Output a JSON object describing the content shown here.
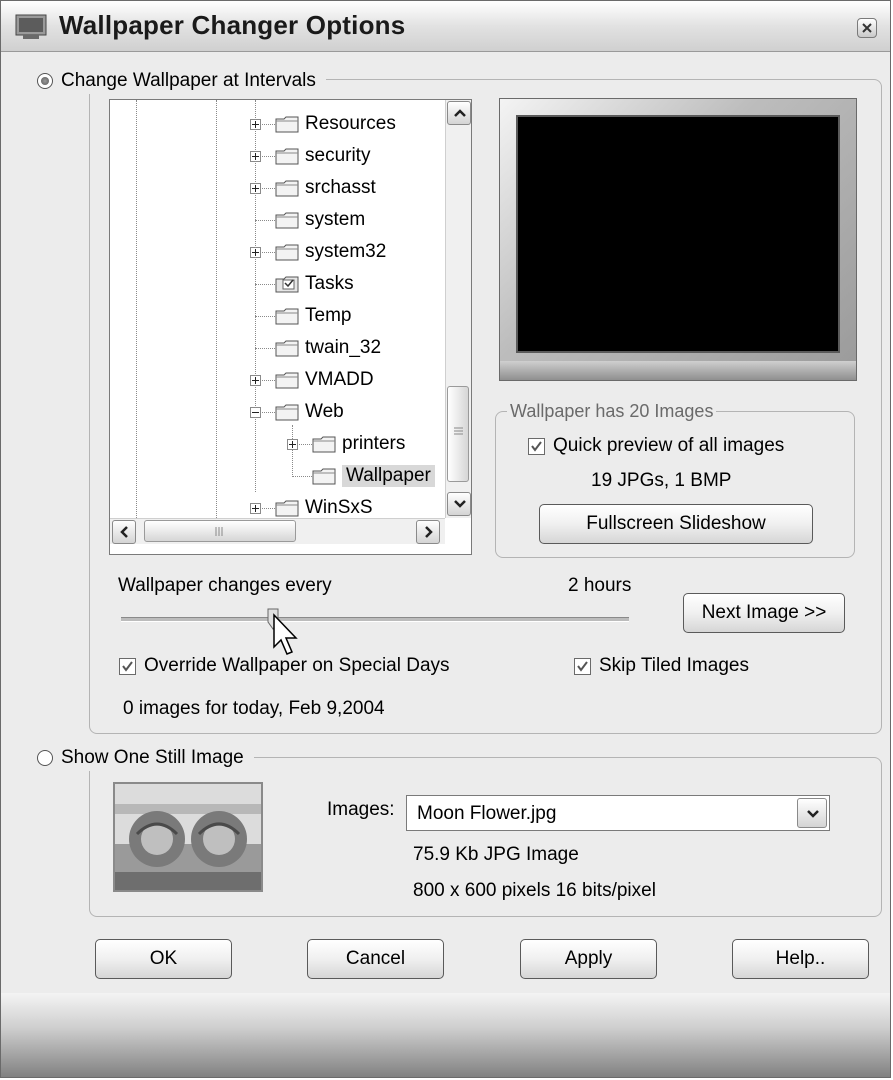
{
  "window": {
    "title": "Wallpaper Changer Options"
  },
  "intervals": {
    "radio_label": "Change Wallpaper at Intervals",
    "selected": true,
    "tree": [
      {
        "label": "Resources",
        "expander": "plus",
        "icon": "folder"
      },
      {
        "label": "security",
        "expander": "plus",
        "icon": "folder"
      },
      {
        "label": "srchasst",
        "expander": "plus",
        "icon": "folder"
      },
      {
        "label": "system",
        "expander": "none",
        "icon": "folder"
      },
      {
        "label": "system32",
        "expander": "plus",
        "icon": "folder"
      },
      {
        "label": "Tasks",
        "expander": "none",
        "icon": "tasks-folder"
      },
      {
        "label": "Temp",
        "expander": "none",
        "icon": "folder"
      },
      {
        "label": "twain_32",
        "expander": "none",
        "icon": "folder"
      },
      {
        "label": "VMADD",
        "expander": "plus",
        "icon": "folder"
      },
      {
        "label": "Web",
        "expander": "minus",
        "icon": "folder"
      },
      {
        "label": "printers",
        "expander": "plus",
        "icon": "folder"
      },
      {
        "label": "Wallpaper",
        "expander": "none",
        "icon": "folder",
        "selected": true
      },
      {
        "label": "WinSxS",
        "expander": "plus",
        "icon": "folder"
      }
    ],
    "info_group": {
      "legend": "Wallpaper has 20 Images",
      "quick_preview_label": "Quick preview of all images",
      "quick_preview_checked": true,
      "counts": "19 JPGs, 1 BMP",
      "slideshow_button": "Fullscreen Slideshow"
    },
    "interval_label": "Wallpaper changes every",
    "interval_value": "2 hours",
    "slider_fraction": 0.3,
    "next_button": "Next Image >>",
    "override_label": "Override Wallpaper on Special Days",
    "override_checked": true,
    "skip_tiled_label": "Skip Tiled Images",
    "skip_tiled_checked": true,
    "today_text": "0 images for today, Feb 9,2004"
  },
  "still": {
    "radio_label": "Show One Still Image",
    "selected": false,
    "images_label": "Images:",
    "images_value": "Moon Flower.jpg",
    "file_info": "75.9 Kb  JPG Image",
    "dimensions": "800 x 600 pixels   16 bits/pixel"
  },
  "buttons": {
    "ok": "OK",
    "cancel": "Cancel",
    "apply": "Apply",
    "help": "Help.."
  }
}
